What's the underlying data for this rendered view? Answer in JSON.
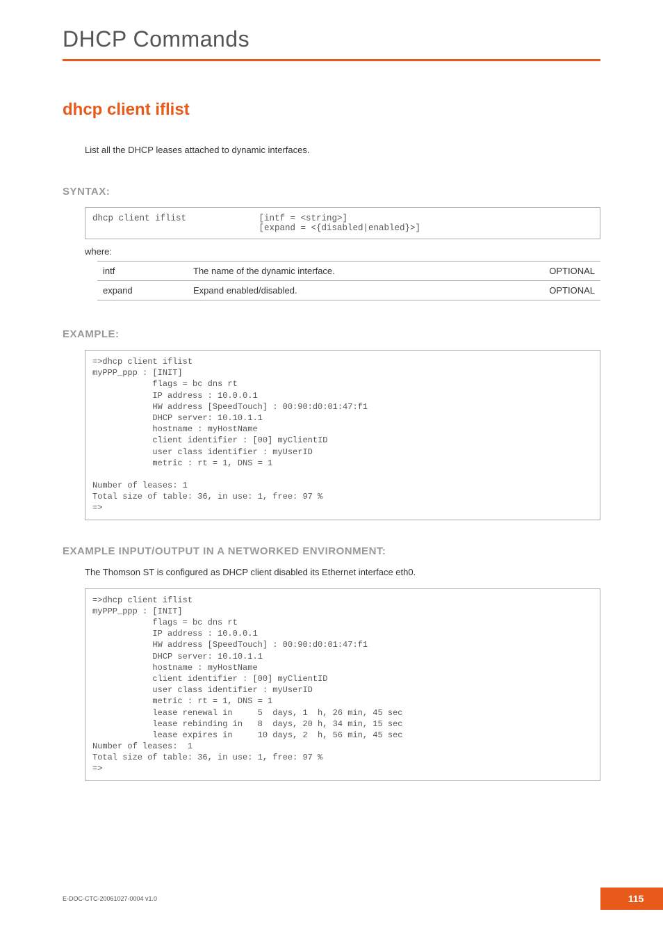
{
  "chapter_title": "DHCP Commands",
  "command_title": "dhcp client iflist",
  "description": "List all the DHCP leases attached to dynamic interfaces.",
  "syntax_heading": "SYNTAX:",
  "syntax_command": "dhcp client iflist",
  "syntax_args": "[intf = <string>]\n[expand = <{disabled|enabled}>]",
  "where_label": "where:",
  "params": [
    {
      "name": "intf",
      "desc": "The name of the dynamic interface.",
      "opt": "OPTIONAL"
    },
    {
      "name": "expand",
      "desc": "Expand enabled/disabled.",
      "opt": "OPTIONAL"
    }
  ],
  "example_heading": "EXAMPLE:",
  "example_code": "=>dhcp client iflist\nmyPPP_ppp : [INIT]\n            flags = bc dns rt\n            IP address : 10.0.0.1\n            HW address [SpeedTouch] : 00:90:d0:01:47:f1\n            DHCP server: 10.10.1.1\n            hostname : myHostName\n            client identifier : [00] myClientID\n            user class identifier : myUserID\n            metric : rt = 1, DNS = 1\n\nNumber of leases: 1\nTotal size of table: 36, in use: 1, free: 97 %\n=>",
  "env_heading": "EXAMPLE INPUT/OUTPUT IN A NETWORKED ENVIRONMENT:",
  "env_note": "The Thomson ST is configured as DHCP client disabled its Ethernet interface eth0.",
  "env_code": "=>dhcp client iflist\nmyPPP_ppp : [INIT]\n            flags = bc dns rt\n            IP address : 10.0.0.1\n            HW address [SpeedTouch] : 00:90:d0:01:47:f1\n            DHCP server: 10.10.1.1\n            hostname : myHostName\n            client identifier : [00] myClientID\n            user class identifier : myUserID\n            metric : rt = 1, DNS = 1\n            lease renewal in     5  days, 1  h, 26 min, 45 sec\n            lease rebinding in   8  days, 20 h, 34 min, 15 sec\n            lease expires in     10 days, 2  h, 56 min, 45 sec\nNumber of leases:  1\nTotal size of table: 36, in use: 1, free: 97 %\n=>",
  "footer_doc": "E-DOC-CTC-20061027-0004 v1.0",
  "page_number": "115"
}
